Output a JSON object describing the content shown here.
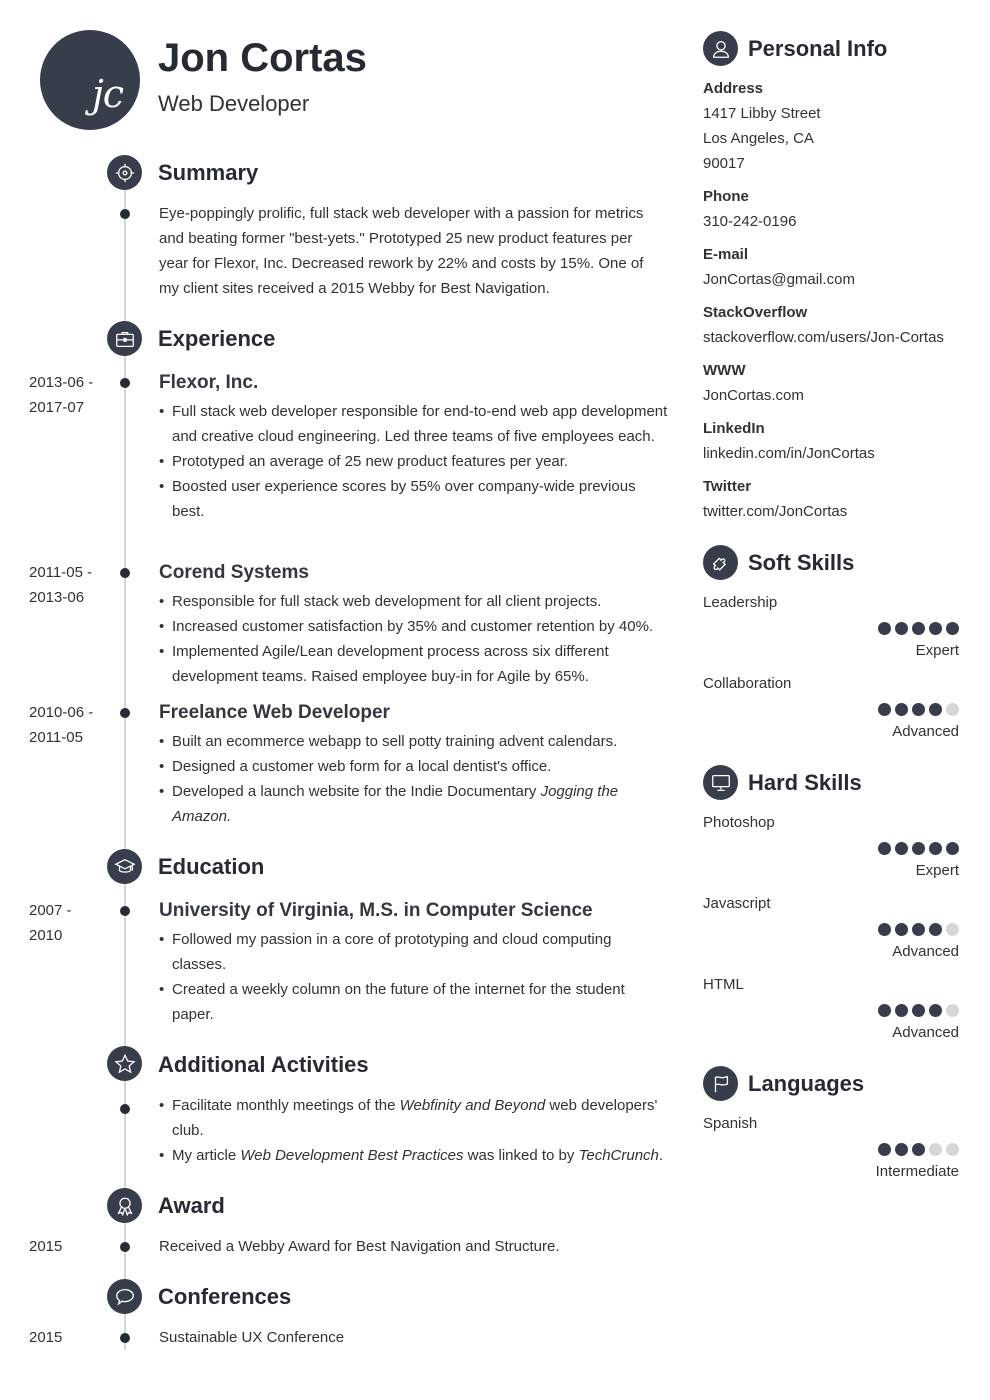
{
  "header": {
    "initials": "jc",
    "name": "Jon Cortas",
    "title": "Web Developer"
  },
  "summary": {
    "heading": "Summary",
    "icon": "target-icon",
    "text": "Eye-poppingly prolific, full stack web developer with a passion for metrics and beating former \"best-yets.\" Prototyped 25 new product features per year for Flexor, Inc. Decreased rework by 22% and costs by 15%. One of my client sites received a 2015 Webby for Best Navigation."
  },
  "experience": {
    "heading": "Experience",
    "icon": "briefcase-icon",
    "jobs": [
      {
        "date_start": "2013-06 -",
        "date_end": "2017-07",
        "title": "Flexor, Inc.",
        "bullets": [
          "Full stack web developer responsible for end-to-end web app development and creative cloud engineering. Led three teams of five employees each.",
          "Prototyped an average of 25 new product features per year.",
          "Boosted user experience scores by 55% over company-wide previous best."
        ]
      },
      {
        "date_start": "2011-05 -",
        "date_end": "2013-06",
        "title": "Corend Systems",
        "bullets": [
          "Responsible for full stack web development for all client projects.",
          "Increased customer satisfaction by 35% and customer retention by 40%.",
          "Implemented Agile/Lean development process across six different development teams. Raised employee buy-in for Agile by 65%."
        ]
      },
      {
        "date_start": "2010-06 -",
        "date_end": "2011-05",
        "title": "Freelance Web Developer",
        "bullets": [
          "Built an ecommerce webapp to sell potty training advent calendars.",
          "Designed a customer web form for a local dentist's office.",
          "Developed a launch website for the Indie Documentary "
        ],
        "bullet3_italic": "Jogging the Amazon",
        "bullet3_end": "."
      }
    ]
  },
  "education": {
    "heading": "Education",
    "icon": "graduation-cap-icon",
    "date_start": "2007 -",
    "date_end": "2010",
    "title": "University of Virginia, M.S. in Computer Science",
    "bullets": [
      "Followed my passion in a core of prototyping and cloud computing classes.",
      "Created a weekly column on the future of the internet for the student paper."
    ]
  },
  "activities": {
    "heading": "Additional Activities",
    "icon": "star-icon",
    "b1_pre": "Facilitate monthly meetings of the ",
    "b1_italic": "Webfinity and Beyond",
    "b1_post": " web developers' club.",
    "b2_pre": "My article ",
    "b2_italic": "Web Development Best Practices",
    "b2_mid": " was linked to by ",
    "b2_italic2": "TechCrunch",
    "b2_post": "."
  },
  "award": {
    "heading": "Award",
    "icon": "award-ribbon-icon",
    "date": "2015",
    "text": "Received a Webby Award for Best Navigation and Structure."
  },
  "conferences": {
    "heading": "Conferences",
    "icon": "speech-bubble-icon",
    "date": "2015",
    "text": "Sustainable UX Conference"
  },
  "personal_info": {
    "heading": "Personal Info",
    "icon": "user-icon",
    "address_label": "Address",
    "address_lines": [
      "1417 Libby Street",
      "Los Angeles, CA",
      "90017"
    ],
    "phone_label": "Phone",
    "phone": "310-242-0196",
    "email_label": "E-mail",
    "email": "JonCortas@gmail.com",
    "stackoverflow_label": "StackOverflow",
    "stackoverflow": "stackoverflow.com/users/Jon-Cortas",
    "www_label": "WWW",
    "www": "JonCortas.com",
    "linkedin_label": "LinkedIn",
    "linkedin": "linkedin.com/in/JonCortas",
    "twitter_label": "Twitter",
    "twitter": "twitter.com/JonCortas"
  },
  "soft_skills": {
    "heading": "Soft Skills",
    "icon": "puzzle-piece-icon",
    "items": [
      {
        "name": "Leadership",
        "rating": 5,
        "max": 5,
        "level": "Expert"
      },
      {
        "name": "Collaboration",
        "rating": 4,
        "max": 5,
        "level": "Advanced"
      }
    ]
  },
  "hard_skills": {
    "heading": "Hard Skills",
    "icon": "monitor-icon",
    "items": [
      {
        "name": "Photoshop",
        "rating": 5,
        "max": 5,
        "level": "Expert"
      },
      {
        "name": "Javascript",
        "rating": 4,
        "max": 5,
        "level": "Advanced"
      },
      {
        "name": "HTML",
        "rating": 4,
        "max": 5,
        "level": "Advanced"
      }
    ]
  },
  "languages": {
    "heading": "Languages",
    "icon": "flag-icon",
    "items": [
      {
        "name": "Spanish",
        "rating": 3,
        "max": 5,
        "level": "Intermediate"
      }
    ]
  },
  "colors": {
    "accent": "#373d4a",
    "text": "#2f3237",
    "rating_off": "#d6d6d6",
    "timeline": "#d6d6d6"
  }
}
